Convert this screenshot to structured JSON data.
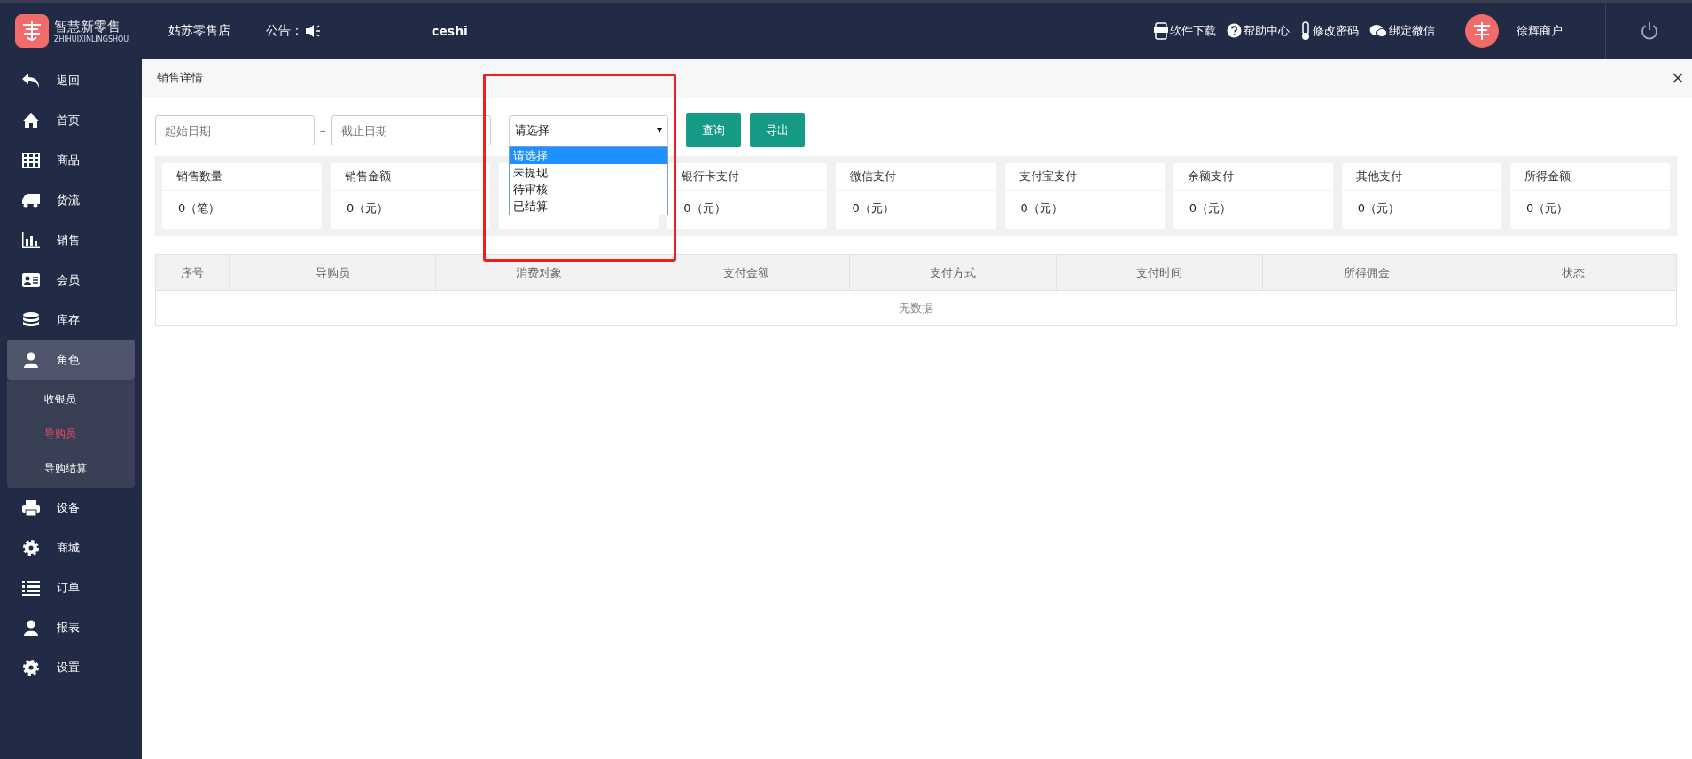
{
  "header": {
    "logo_title": "智慧新零售",
    "logo_subtitle": "ZHIHUIXINLINGSHOU",
    "store": "姑苏零售店",
    "notice_label": "公告：",
    "notice_text": "ceshi",
    "links": [
      {
        "kind": "app",
        "label": "软件下载"
      },
      {
        "kind": "help",
        "label": "帮助中心"
      },
      {
        "kind": "password",
        "label": "修改密码"
      },
      {
        "kind": "wechat",
        "label": "绑定微信"
      }
    ],
    "user": "徐辉商户"
  },
  "sidebar": {
    "items": [
      {
        "kind": "back",
        "label": "返回",
        "selected": false
      },
      {
        "kind": "home",
        "label": "首页",
        "selected": false
      },
      {
        "kind": "grid",
        "label": "商品",
        "selected": false
      },
      {
        "kind": "truck",
        "label": "货流",
        "selected": false
      },
      {
        "kind": "chart",
        "label": "销售",
        "selected": false
      },
      {
        "kind": "card",
        "label": "会员",
        "selected": false
      },
      {
        "kind": "database",
        "label": "库存",
        "selected": false
      },
      {
        "kind": "user",
        "label": "角色",
        "selected": true,
        "expanded": true,
        "children": [
          {
            "label": "收银员",
            "selected": false
          },
          {
            "label": "导购员",
            "selected": true
          },
          {
            "label": "导购结算",
            "selected": false
          }
        ]
      },
      {
        "kind": "printer",
        "label": "设备",
        "selected": false
      },
      {
        "kind": "gear",
        "label": "商城",
        "selected": false
      },
      {
        "kind": "list",
        "label": "订单",
        "selected": false
      },
      {
        "kind": "user",
        "label": "报表",
        "selected": false
      },
      {
        "kind": "gear",
        "label": "设置",
        "selected": false
      }
    ]
  },
  "page_tab": {
    "title": "销售详情"
  },
  "filters": {
    "start_placeholder": "起始日期",
    "separator": "–",
    "end_placeholder": "截止日期",
    "select_value": "请选择",
    "select_options": [
      {
        "label": "请选择",
        "selected": true
      },
      {
        "label": "未提现",
        "selected": false
      },
      {
        "label": "待审核",
        "selected": false
      },
      {
        "label": "已结算",
        "selected": false
      }
    ],
    "buttons": [
      "查询",
      "导出"
    ]
  },
  "cards": [
    {
      "title": "销售数量",
      "value": "0（笔）"
    },
    {
      "title": "销售金额",
      "value": "0（元）"
    },
    {
      "covered": true
    },
    {
      "title": "银行卡支付",
      "value": "0（元）"
    },
    {
      "title": "微信支付",
      "value": "0（元）"
    },
    {
      "title": "支付宝支付",
      "value": "0（元）"
    },
    {
      "title": "余额支付",
      "value": "0（元）"
    },
    {
      "title": "其他支付",
      "value": "0（元）"
    },
    {
      "title": "所得金额",
      "value": "0（元）"
    }
  ],
  "table": {
    "columns": [
      "序号",
      "导购员",
      "消费对象",
      "支付金额",
      "支付方式",
      "支付时间",
      "所得佣金",
      "状态"
    ],
    "empty_text": "无数据"
  }
}
